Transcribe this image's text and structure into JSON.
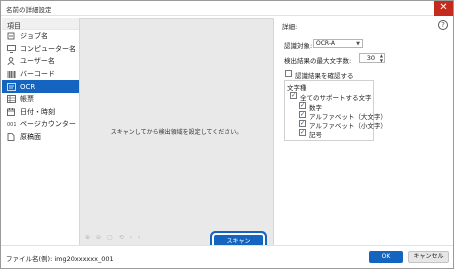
{
  "window": {
    "title": "名前の詳細設定",
    "close_glyph": "✕"
  },
  "sidebar": {
    "header": "項目",
    "items": [
      {
        "label": "ジョブ名",
        "icon": "job-icon"
      },
      {
        "label": "コンピューター名",
        "icon": "computer-icon"
      },
      {
        "label": "ユーザー名",
        "icon": "user-icon"
      },
      {
        "label": "バーコード",
        "icon": "barcode-icon"
      },
      {
        "label": "OCR",
        "icon": "ocr-icon",
        "active": true
      },
      {
        "label": "帳票",
        "icon": "form-icon"
      },
      {
        "label": "日付・時刻",
        "icon": "calendar-icon"
      },
      {
        "label": "ページカウンター",
        "icon": "page-counter-icon"
      },
      {
        "label": "原稿面",
        "icon": "document-side-icon"
      }
    ]
  },
  "preview": {
    "message": "スキャンしてから検出領域を設定してください。",
    "scan_button": "スキャン"
  },
  "details": {
    "header": "詳細:",
    "help_glyph": "?",
    "target_label": "認識対象:",
    "target_value": "OCR-A",
    "max_chars_label": "検出結果の最大文字数:",
    "max_chars_value": "30",
    "confirm_label": "認識結果を確認する",
    "char_type_label": "文字種",
    "all_label": "全てのサポートする文字",
    "options": [
      "数字",
      "アルファベット（大文字）",
      "アルファベット（小文字）",
      "記号"
    ]
  },
  "footer": {
    "filename_label": "ファイル名(例):",
    "filename_value": "img20xxxxxx_001",
    "ok": "OK",
    "cancel": "キャンセル"
  },
  "colors": {
    "accent": "#1565c0",
    "close": "#c42b1c",
    "preview_bg": "#e9e9e9"
  }
}
